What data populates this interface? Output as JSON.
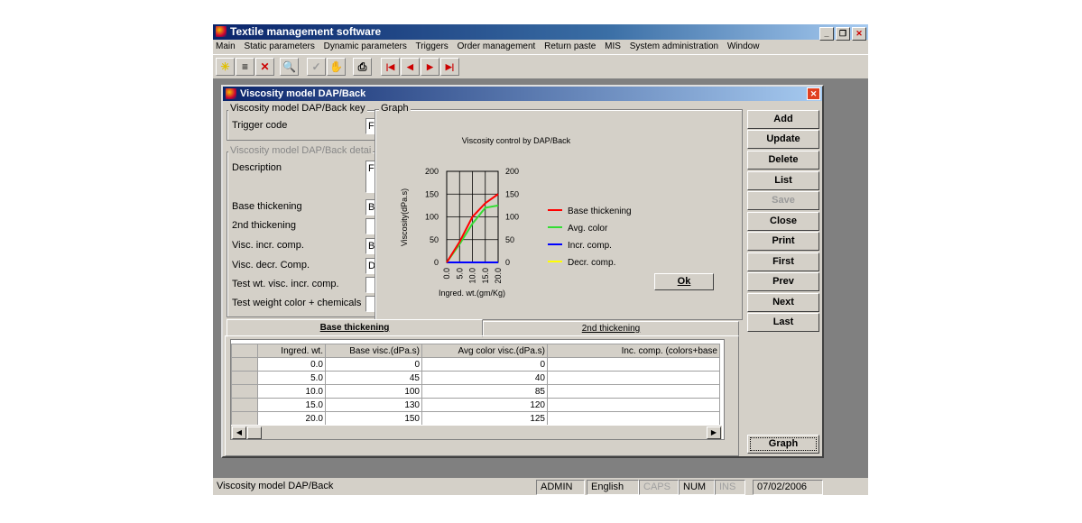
{
  "app": {
    "title": "Textile management software",
    "menu": [
      "Main",
      "Static parameters",
      "Dynamic parameters",
      "Triggers",
      "Order management",
      "Return paste",
      "MIS",
      "System administration",
      "Window"
    ]
  },
  "dialog": {
    "title": "Viscosity model DAP/Back",
    "key_group": "Viscosity model DAP/Back key",
    "detail_group": "Viscosity model DAP/Back detai",
    "labels": {
      "trigger_code": "Trigger code",
      "description": "Description",
      "base_thickening": "Base thickening",
      "second_thickening": "2nd thickening",
      "visc_incr_comp": "Visc. incr. comp.",
      "visc_decr_comp": "Visc. decr. Comp.",
      "test_wt": "Test wt. visc. incr. comp.",
      "test_weight_color": "Test weight color + chemicals"
    },
    "field_values": {
      "trigger_code": "F",
      "description": "F",
      "base_thickening": "B",
      "visc_incr_comp": "B",
      "visc_decr_comp": "D"
    },
    "buttons": [
      "Add",
      "Update",
      "Delete",
      "List",
      "Save",
      "Close",
      "Print",
      "First",
      "Prev",
      "Next",
      "Last"
    ],
    "graph_button": "Graph",
    "tabs": [
      "Base thickening",
      "2nd thickening"
    ]
  },
  "graph": {
    "group_label": "Graph",
    "ok_label": "Ok",
    "chart_data": {
      "type": "line",
      "title": "Viscosity control by DAP/Back",
      "xlabel": "Ingred. wt.(gm/Kg)",
      "ylabel": "Viscosity(dPa.s)",
      "x": [
        0.0,
        5.0,
        10.0,
        15.0,
        20.0
      ],
      "x_ticks": [
        "0.0",
        "5.0",
        "10.0",
        "15.0",
        "20.0"
      ],
      "y_ticks": [
        "0",
        "50",
        "100",
        "150",
        "200"
      ],
      "ylim": [
        0,
        200
      ],
      "grid": true,
      "legend_position": "right",
      "series": [
        {
          "name": "Base thickening",
          "color": "#ff0000",
          "values": [
            0,
            45,
            100,
            130,
            150
          ]
        },
        {
          "name": "Avg. color",
          "color": "#33dd33",
          "values": [
            0,
            40,
            85,
            120,
            125
          ]
        },
        {
          "name": "Incr. comp.",
          "color": "#0000ff",
          "values": [
            0,
            0,
            0,
            0,
            0
          ]
        },
        {
          "name": "Decr. comp.",
          "color": "#ffff00",
          "values": [
            0,
            0,
            0,
            0,
            0
          ]
        }
      ]
    }
  },
  "table": {
    "headers": [
      "",
      "Ingred. wt.",
      "Base visc.(dPa.s)",
      "Avg color visc.(dPa.s)",
      "Inc. comp. (colors+base"
    ],
    "rows": [
      [
        "0.0",
        "0",
        "0"
      ],
      [
        "5.0",
        "45",
        "40"
      ],
      [
        "10.0",
        "100",
        "85"
      ],
      [
        "15.0",
        "130",
        "120"
      ],
      [
        "20.0",
        "150",
        "125"
      ]
    ]
  },
  "status": {
    "message": "Viscosity model DAP/Back",
    "user": "ADMIN",
    "language": "English",
    "caps": "CAPS",
    "num": "NUM",
    "ins": "INS",
    "date": "07/02/2006"
  }
}
